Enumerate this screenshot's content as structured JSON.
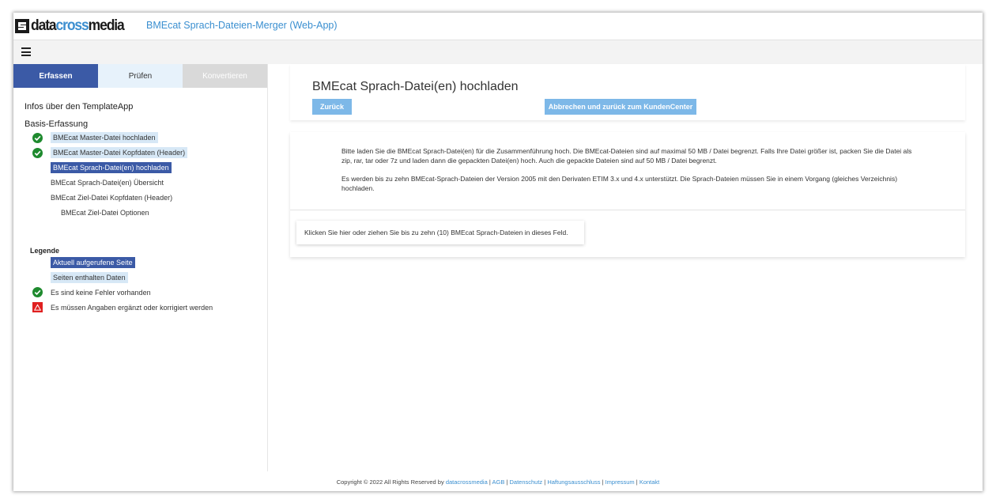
{
  "header": {
    "logo": {
      "part1": "data",
      "part2": "cross",
      "part3": "media"
    },
    "app_title": "BMEcat Sprach-Dateien-Merger (Web-App)"
  },
  "toolbar": {
    "menu_icon": "hamburger-menu-icon"
  },
  "tabs": [
    {
      "label": "Erfassen",
      "state": "active"
    },
    {
      "label": "Prüfen",
      "state": "normal"
    },
    {
      "label": "Konvertieren",
      "state": "disabled"
    }
  ],
  "sidebar": {
    "info_title": "Infos über den TemplateApp",
    "section_title": "Basis-Erfassung",
    "items": [
      {
        "label": "BMEcat Master-Datei hochladen",
        "status": "ok"
      },
      {
        "label": "BMEcat Master-Datei Kopfdaten (Header)",
        "status": "ok"
      },
      {
        "label": "BMEcat Sprach-Datei(en) hochladen",
        "status": "current"
      },
      {
        "label": "BMEcat Sprach-Datei(en) Übersicht",
        "status": "none"
      },
      {
        "label": "BMEcat Ziel-Datei Kopfdaten (Header)",
        "status": "none"
      },
      {
        "label": "BMEcat Ziel-Datei Optionen",
        "status": "none"
      }
    ],
    "legend": {
      "title": "Legende",
      "current": "Aktuell aufgerufene Seite",
      "data": "Seiten enthalten Daten",
      "ok": "Es sind keine Fehler vorhanden",
      "warn": "Es müssen Angaben ergänzt oder korrigiert werden"
    }
  },
  "main": {
    "title": "BMEcat Sprach-Datei(en) hochladen",
    "back_button": "Zurück",
    "cancel_button": "Abbrechen und zurück zum KundenCenter",
    "paragraph1": "Bitte laden Sie die BMEcat Sprach-Datei(en) für die Zusammenführung hoch. Die BMEcat-Dateien sind auf maximal 50 MB / Datei begrenzt. Falls Ihre Datei größer ist, packen Sie die Datei als zip, rar, tar oder 7z und laden dann die gepackten Datei(en) hoch. Auch die gepackte Dateien sind auf 50 MB / Datei begrenzt.",
    "paragraph2": "Es werden bis zu zehn BMEcat-Sprach-Dateien der Version 2005 mit den Derivaten ETIM 3.x und 4.x unterstützt. Die Sprach-Dateien müssen Sie in einem Vorgang (gleiches Verzeichnis) hochladen.",
    "dropzone": "Klicken Sie hier oder ziehen Sie bis zu zehn (10) BMEcat Sprach-Dateien in dieses Feld."
  },
  "footer": {
    "copyright": "Copyright © 2022 All Rights Reserved by",
    "brand_link": "datacrossmedia",
    "links": [
      "AGB",
      "Datenschutz",
      "Haftungsausschluss",
      "Impressum",
      "Kontakt"
    ]
  },
  "colors": {
    "accent": "#3b5aa6",
    "link": "#3a8fd0",
    "button": "#7db8e8",
    "ok_green": "#1e8a2e",
    "warn_red": "#e02020",
    "data_highlight": "#d7e8f6"
  }
}
